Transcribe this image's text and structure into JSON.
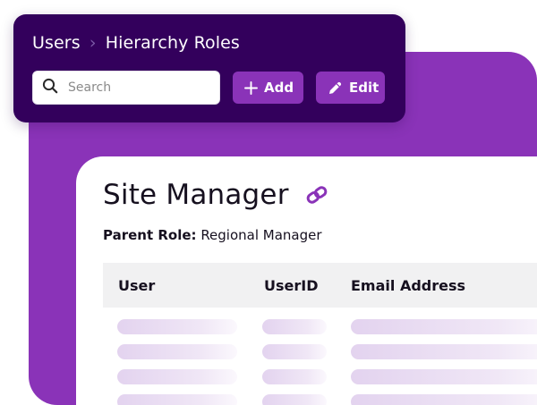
{
  "breadcrumb": {
    "items": [
      "Users",
      "Hierarchy Roles"
    ],
    "separator": "›"
  },
  "search": {
    "placeholder": "Search",
    "value": ""
  },
  "actions": {
    "add_label": "Add",
    "edit_label": "Edit"
  },
  "page": {
    "title": "Site Manager",
    "parent_role_label": "Parent Role:",
    "parent_role_value": "Regional Manager"
  },
  "table": {
    "columns": [
      "User",
      "UserID",
      "Email Address"
    ],
    "rows": [
      {
        "loading": true
      },
      {
        "loading": true
      },
      {
        "loading": true
      },
      {
        "loading": true
      }
    ]
  },
  "icons": {
    "search": "search-icon",
    "add": "plus-icon",
    "edit": "pencil-icon",
    "link": "link-icon"
  },
  "colors": {
    "toolbar_bg": "#33005C",
    "brand_purple": "#8A33B8",
    "separator": "#7B5AA6",
    "header_row_bg": "#F1F1F2",
    "skeleton": "#E3D3EF"
  }
}
